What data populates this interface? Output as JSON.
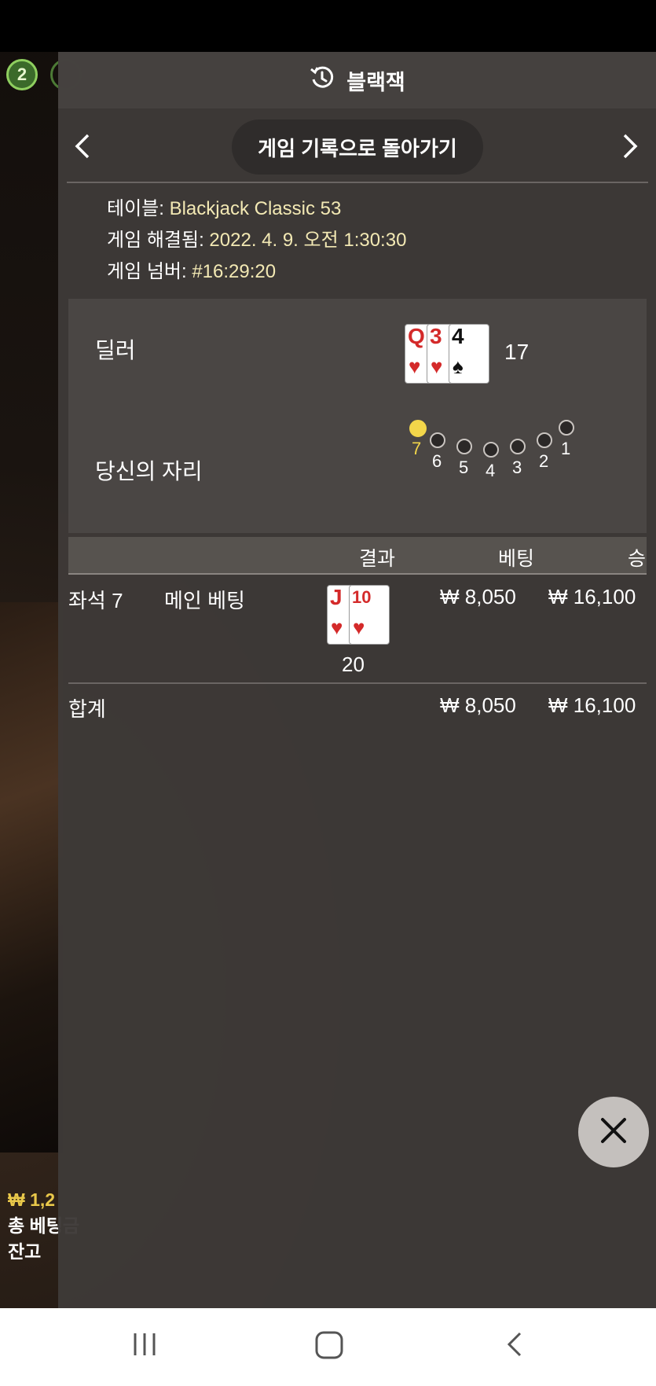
{
  "left_panel": {
    "badge_number": "2",
    "balance_line": "₩ 1,2",
    "total_bet_label": "총 베팅금",
    "balance_label": "잔고"
  },
  "header": {
    "title": "블랙잭",
    "back_button": "게임 기록으로 돌아가기",
    "icons": {
      "history": "history-icon",
      "prev": "chevron-left-icon",
      "next": "chevron-right-icon"
    }
  },
  "info": {
    "table_label": "테이블:",
    "table_value": "Blackjack Classic 53",
    "resolved_label": "게임 해결됨:",
    "resolved_value": "2022. 4. 9. 오전 1:30:30",
    "number_label": "게임 넘버:",
    "number_value": "#16:29:20"
  },
  "dealer": {
    "label": "딜러",
    "cards": [
      {
        "rank": "Q",
        "suit": "♥",
        "color": "red"
      },
      {
        "rank": "3",
        "suit": "♥",
        "color": "red"
      },
      {
        "rank": "4",
        "suit": "♠",
        "color": "black"
      }
    ],
    "total": "17"
  },
  "seats": {
    "label": "당신의 자리",
    "list": [
      {
        "num": "7",
        "active": true
      },
      {
        "num": "6",
        "active": false
      },
      {
        "num": "5",
        "active": false
      },
      {
        "num": "4",
        "active": false
      },
      {
        "num": "3",
        "active": false
      },
      {
        "num": "2",
        "active": false
      },
      {
        "num": "1",
        "active": false
      }
    ]
  },
  "table": {
    "headers": {
      "result": "결과",
      "bet": "베팅",
      "win": "승"
    },
    "row": {
      "seat": "좌석 7",
      "type": "메인 베팅",
      "cards": [
        {
          "rank": "J",
          "suit": "♥",
          "color": "red"
        },
        {
          "rank": "10",
          "suit": "♥",
          "color": "red"
        }
      ],
      "hand_total": "20",
      "bet": "₩ 8,050",
      "win": "₩ 16,100"
    },
    "total": {
      "label": "합계",
      "bet": "₩ 8,050",
      "win": "₩ 16,100"
    }
  },
  "colors": {
    "accent_gold": "#f3d64a",
    "panel": "#3e3a38",
    "info_text": "#f3e9b4"
  }
}
